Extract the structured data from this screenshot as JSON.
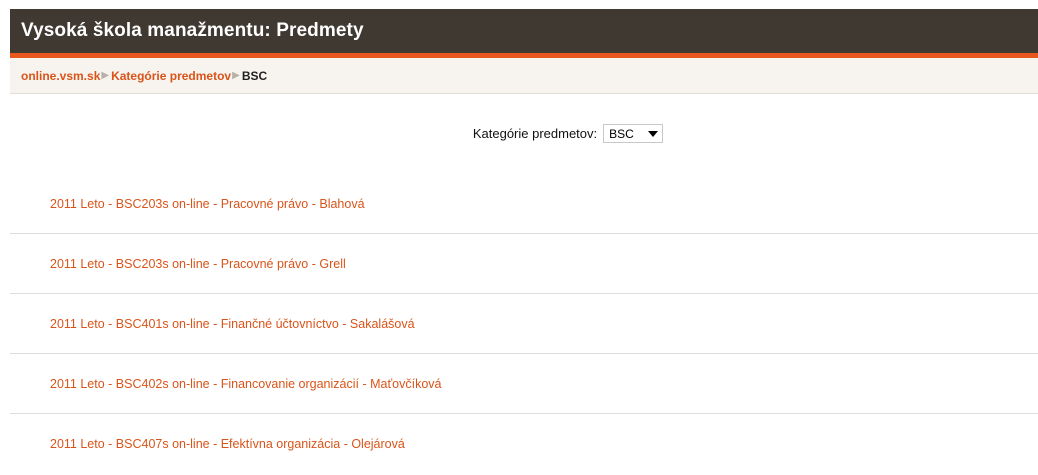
{
  "header": {
    "title": "Vysoká škola manažmentu: Predmety"
  },
  "breadcrumb": {
    "items": [
      {
        "label": "online.vsm.sk"
      },
      {
        "label": "Kategórie predmetov"
      }
    ],
    "separator": "▶",
    "current": "BSC"
  },
  "category_select": {
    "label": "Kategórie predmetov:",
    "value": "BSC"
  },
  "courses": [
    "2011 Leto - BSC203s on-line - Pracovné právo - Blahová",
    "2011 Leto - BSC203s on-line - Pracovné právo - Grell",
    "2011 Leto - BSC401s on-line - Finančné účtovníctvo - Sakalášová",
    "2011 Leto - BSC402s on-line - Financovanie organizácií - Maťovčíková",
    "2011 Leto - BSC407s on-line - Efektívna organizácia - Olejárová"
  ],
  "colors": {
    "header_bg": "#3f3932",
    "accent": "#e8581e",
    "link": "#d9541a",
    "navbar_bg": "#f7f3ee"
  }
}
